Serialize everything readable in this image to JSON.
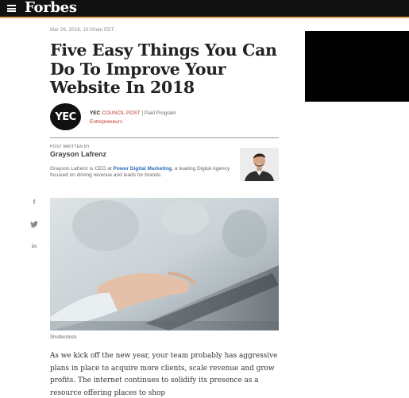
{
  "header": {
    "logo_text": "Forbes",
    "menu_icon": "hamburger-menu-icon",
    "accent_color": "#e3a25a",
    "bar_color": "#111111"
  },
  "article": {
    "dateline": "Mar 26, 2018, 10:00am EDT",
    "title": "Five Easy Things You Can Do To Improve Your Website In 2018",
    "council": {
      "logo_text": "YEC",
      "brand": "YEC",
      "council_label": "COUNCIL POST",
      "separator": "|",
      "paid_label": "Paid Program",
      "channel": "Entrepreneurs",
      "accent_color": "#c0392b"
    },
    "author": {
      "written_by_label": "POST WRITTEN BY",
      "name": "Grayson Lafrenz",
      "bio_prefix": "Grayson Lafrenz is CEO at",
      "bio_link": "Power Digital Marketing",
      "bio_suffix": ", a leading Digital Agency focused on driving revenue and leads for brands."
    },
    "share": {
      "facebook": "f",
      "twitter": "t",
      "linkedin": "in"
    },
    "image_caption": "Shutterstock",
    "body": "As we kick off the new year, your team probably has aggressive plans in place to acquire more clients, scale revenue and grow profits. The internet continues to solidify its presence as a resource offering places to shop"
  }
}
